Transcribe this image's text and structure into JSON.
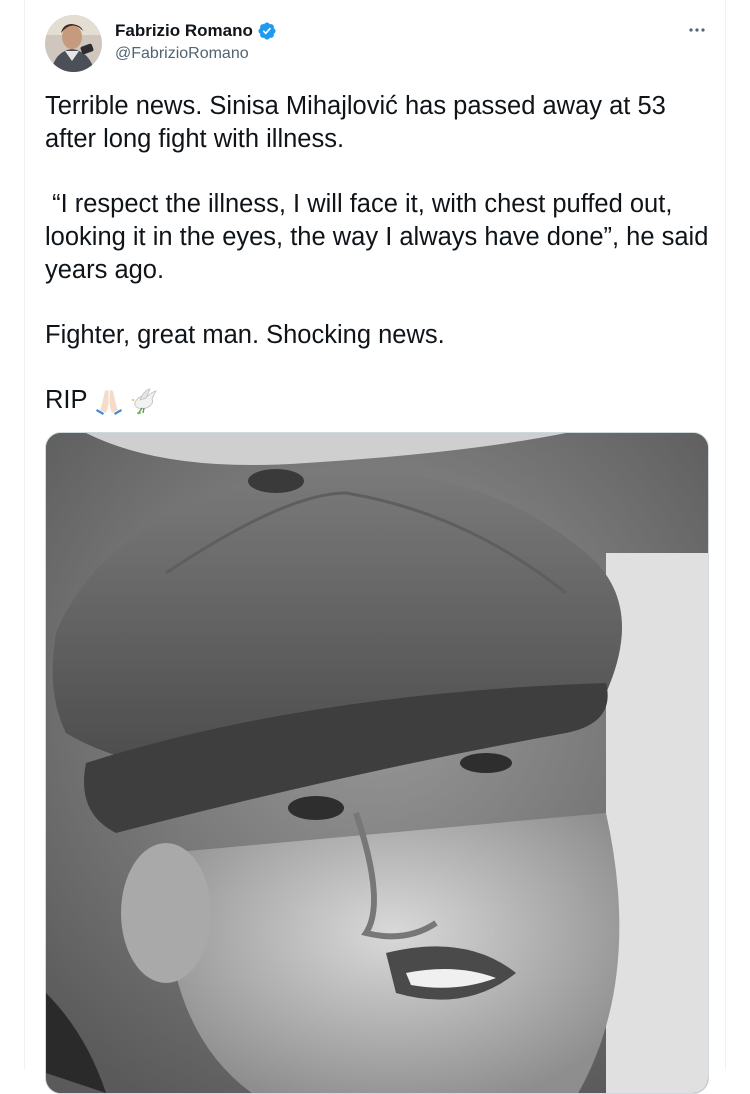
{
  "tweet": {
    "author": {
      "display_name": "Fabrizio Romano",
      "handle": "@FabrizioRomano",
      "verified": true,
      "avatar_icon": "profile-photo"
    },
    "more_icon": "ellipsis-icon",
    "paragraphs": [
      "Terrible news. Sinisa Mihajlović has passed away at 53 after long fight with illness.",
      " “I respect the illness, I will face it, with chest puffed out, looking it in the eyes, the way I always have done”, he said years ago.",
      "Fighter, great man. Shocking news."
    ],
    "rip_text": "RIP",
    "rip_emojis": [
      "folded-hands-emoji",
      "dove-emoji"
    ],
    "media": {
      "type": "photo",
      "description_icon": "black-and-white-portrait-photo"
    }
  },
  "colors": {
    "text_primary": "#0f1419",
    "text_secondary": "#536471",
    "verified_blue": "#1d9bf0",
    "border": "#cfd9de"
  }
}
